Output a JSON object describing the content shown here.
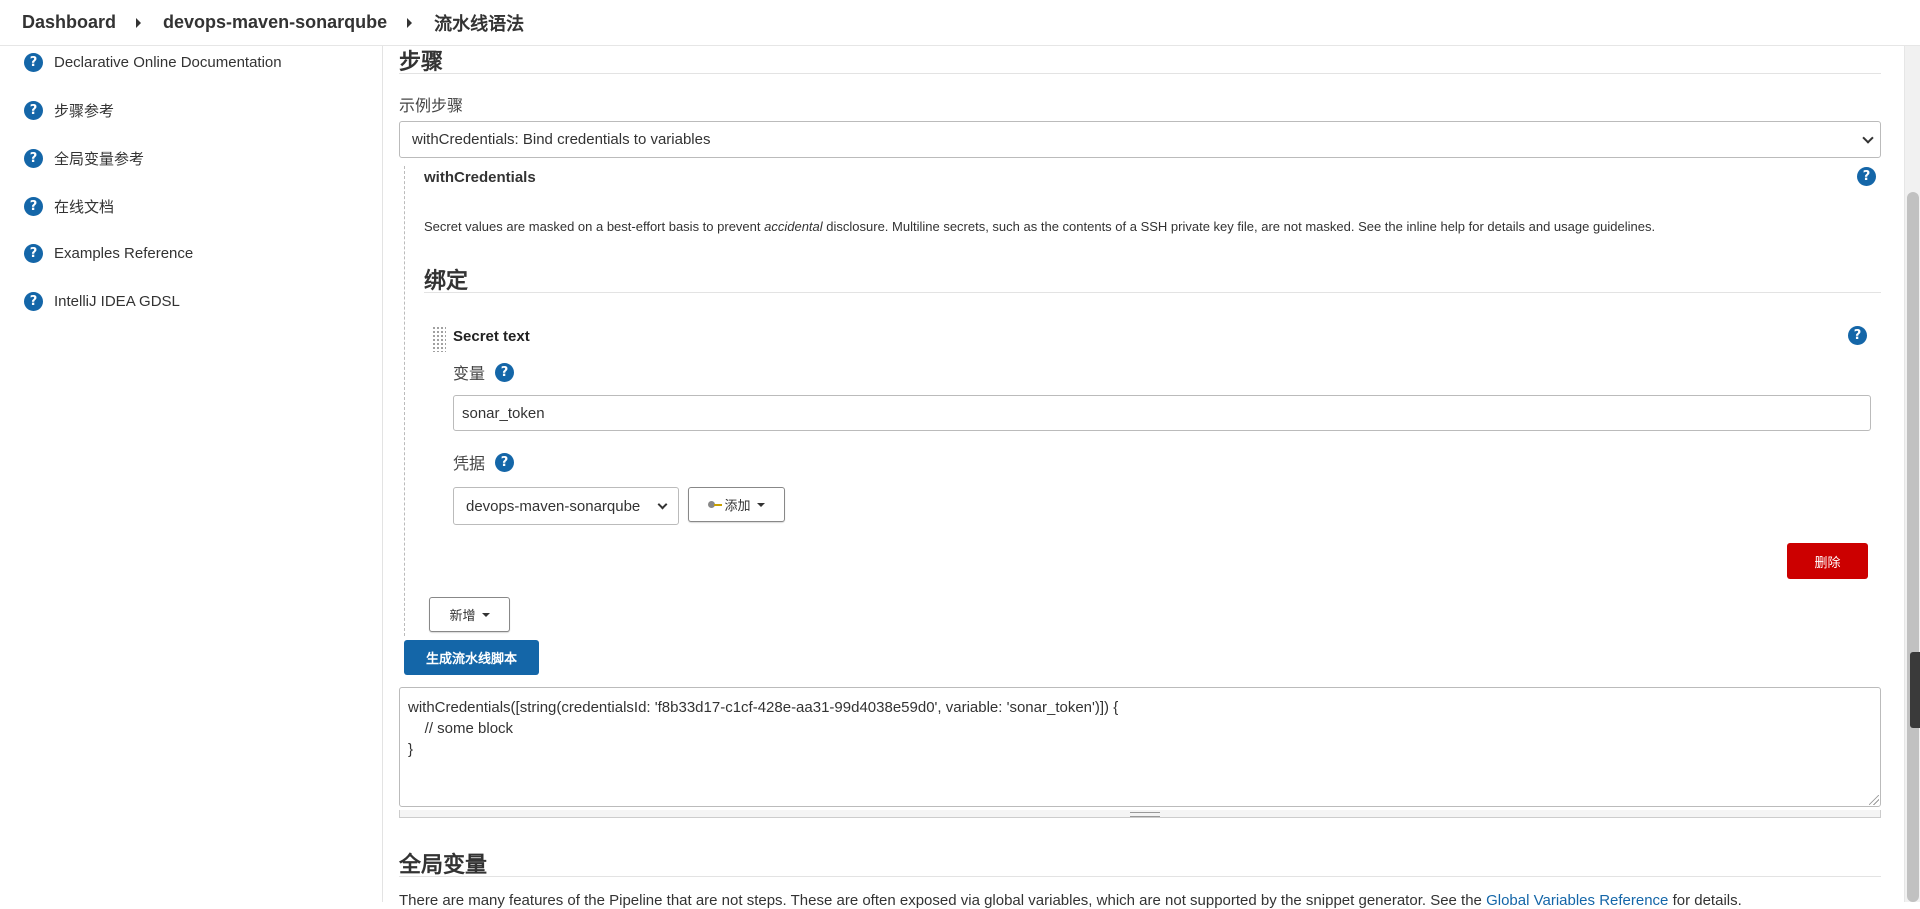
{
  "breadcrumb": {
    "items": [
      "Dashboard",
      "devops-maven-sonarqube",
      "流水线语法"
    ]
  },
  "sidebar": {
    "items": [
      {
        "label": "Declarative Online Documentation"
      },
      {
        "label": "步骤参考"
      },
      {
        "label": "全局变量参考"
      },
      {
        "label": "在线文档"
      },
      {
        "label": "Examples Reference"
      },
      {
        "label": "IntelliJ IDEA GDSL"
      }
    ]
  },
  "main": {
    "steps_heading": "步骤",
    "sample_step_label": "示例步骤",
    "sample_step_selected": "withCredentials: Bind credentials to variables",
    "step_title": "withCredentials",
    "step_description_before": "Secret values are masked on a best-effort basis to prevent ",
    "step_description_em": "accidental",
    "step_description_after": " disclosure. Multiline secrets, such as the contents of a SSH private key file, are not masked. See the inline help for details and usage guidelines.",
    "bindings_heading": "绑定",
    "binding": {
      "title": "Secret text",
      "variable_label": "变量",
      "variable_value": "sonar_token",
      "credentials_label": "凭据",
      "credentials_selected": "devops-maven-sonarqube",
      "add_label": "添加",
      "delete_label": "删除"
    },
    "add_binding_label": "新增",
    "generate_label": "生成流水线脚本",
    "generated_script": "withCredentials([string(credentialsId: 'f8b33d17-c1cf-428e-aa31-99d4038e59d0', variable: 'sonar_token')]) {\n    // some block\n}",
    "global_heading": "全局变量",
    "global_text_before": "There are many features of the Pipeline that are not steps. These are often exposed via global variables, which are not supported by the snippet generator. See the ",
    "global_link": "Global Variables Reference",
    "global_text_after": " for details."
  },
  "colors": {
    "accent": "#1466a8",
    "danger": "#cc0000"
  },
  "icons": {
    "help": "help-icon",
    "key": "key-icon"
  }
}
